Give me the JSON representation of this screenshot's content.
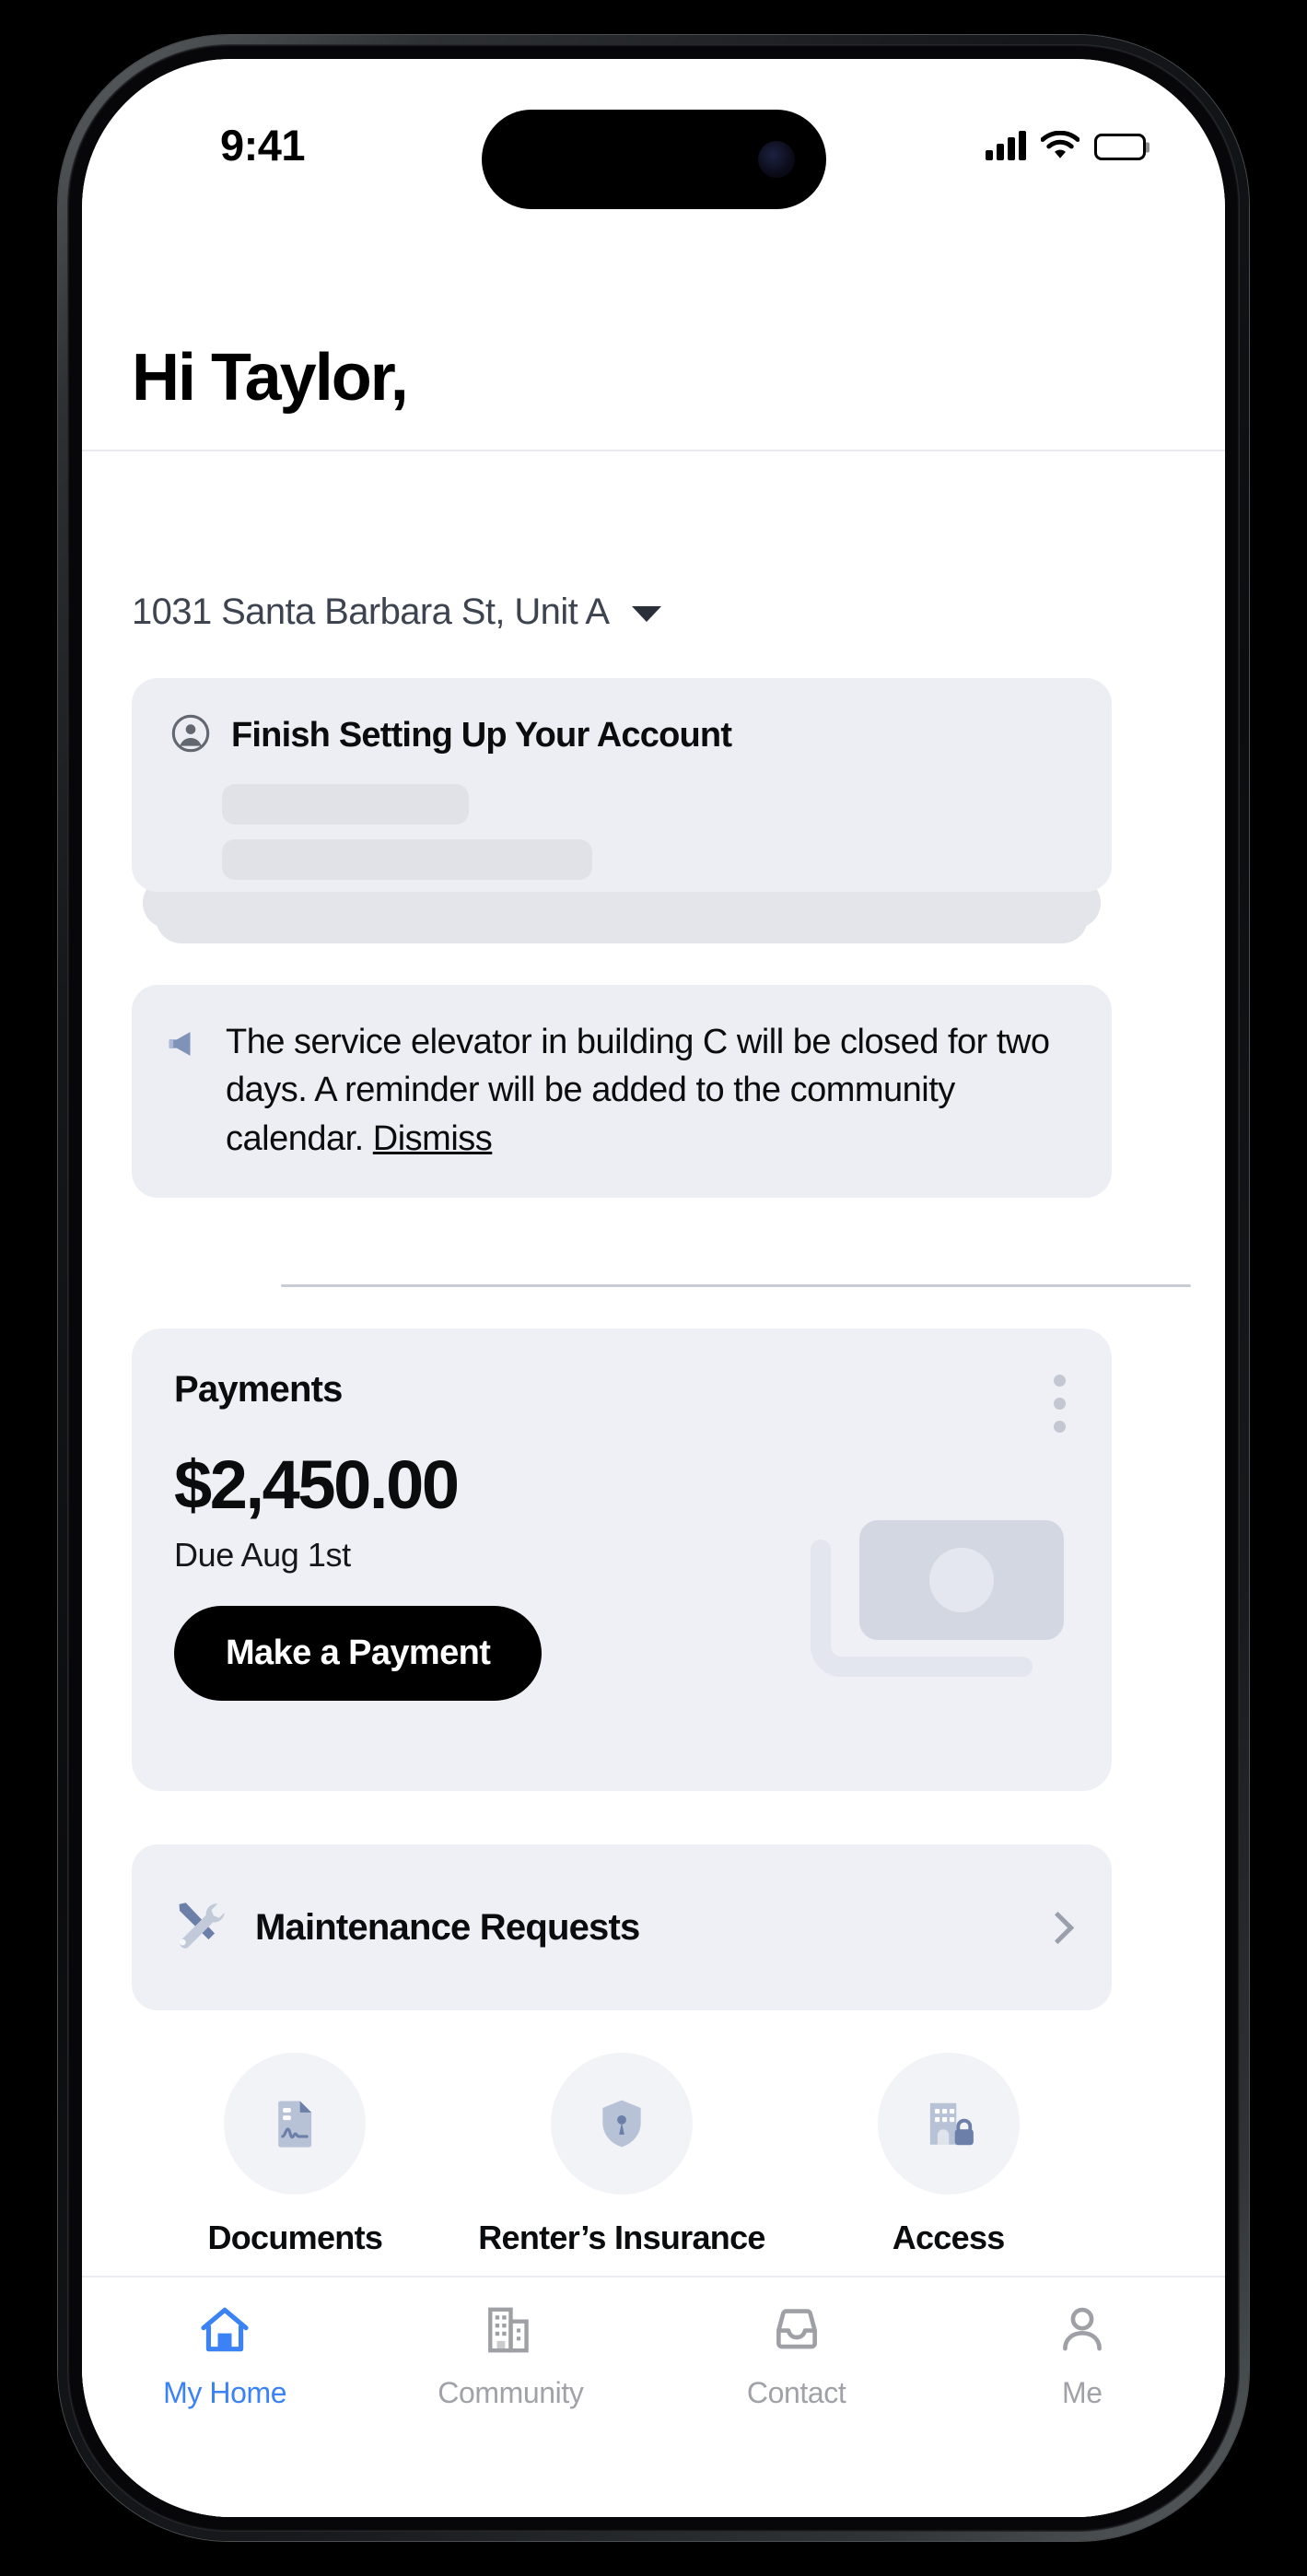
{
  "status_bar": {
    "time": "9:41",
    "signal_icon": "cellular-signal-icon",
    "wifi_icon": "wifi-icon",
    "battery_icon": "battery-full-icon"
  },
  "header": {
    "greeting": "Hi Taylor,",
    "address": "1031 Santa Barbara St, Unit A",
    "caret_icon": "chevron-down-icon"
  },
  "setup_card": {
    "title": "Finish Setting Up Your Account",
    "avatar_icon": "user-circle-icon"
  },
  "announcement": {
    "icon": "megaphone-icon",
    "message": "The service elevator in building C will be closed for two days. A reminder will be added to the community calendar.",
    "dismiss_label": "Dismiss"
  },
  "payments": {
    "title": "Payments",
    "menu_icon": "more-vertical-icon",
    "amount": "$2,450.00",
    "due_text": "Due Aug 1st",
    "button_label": "Make a Payment",
    "illustration_icon": "banknotes-icon"
  },
  "maintenance": {
    "label": "Maintenance Requests",
    "icon": "wrench-screwdriver-icon",
    "chevron_icon": "chevron-right-icon"
  },
  "quick_actions": [
    {
      "label": "Documents",
      "icon": "document-signature-icon"
    },
    {
      "label": "Renter’s Insurance",
      "icon": "shield-keyhole-icon"
    },
    {
      "label": "Access",
      "icon": "building-lock-icon"
    }
  ],
  "tab_bar": [
    {
      "label": "My Home",
      "icon": "home-icon",
      "active": true
    },
    {
      "label": "Community",
      "icon": "buildings-icon",
      "active": false
    },
    {
      "label": "Contact",
      "icon": "inbox-icon",
      "active": false
    },
    {
      "label": "Me",
      "icon": "person-icon",
      "active": false
    }
  ],
  "colors": {
    "accent_blue": "#3b82f6",
    "inactive_gray": "#a0a2a7",
    "card_background": "#eceef3",
    "icon_slate": "#6b7fa8"
  }
}
